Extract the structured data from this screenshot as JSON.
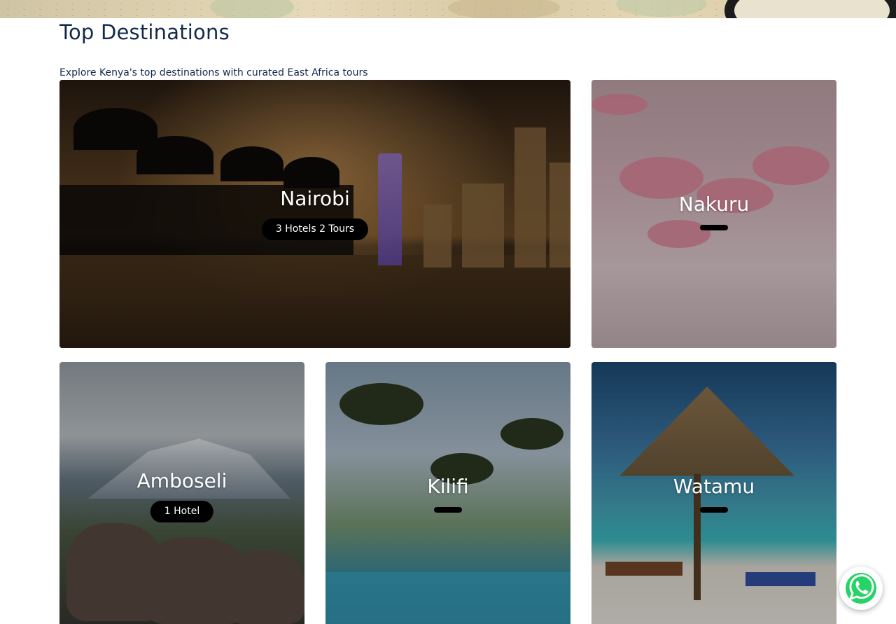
{
  "header": {
    "title": "Top Destinations",
    "subtitle": "Explore Kenya's top destinations with curated East Africa tours"
  },
  "destinations": [
    {
      "name": "Nairobi",
      "badge": "3 Hotels 2 Tours"
    },
    {
      "name": "Nakuru",
      "badge": ""
    },
    {
      "name": "Amboseli",
      "badge": "1 Hotel"
    },
    {
      "name": "Kilifi",
      "badge": ""
    },
    {
      "name": "Watamu",
      "badge": ""
    }
  ],
  "floating": {
    "icon": "whatsapp-icon",
    "color": "#25D366"
  },
  "colors": {
    "heading": "#13294b",
    "badge_bg": "#000000",
    "badge_text": "#ffffff"
  }
}
